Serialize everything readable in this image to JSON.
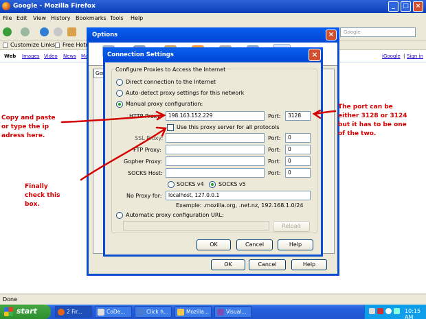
{
  "browser": {
    "title": "Google - Mozilla Firefox",
    "menu": [
      "File",
      "Edit",
      "View",
      "History",
      "Bookmarks",
      "Tools",
      "Help"
    ],
    "search_placeholder": "Google",
    "bookmarks": [
      "Customize Links",
      "Free Hotm"
    ],
    "google_links": [
      "Web",
      "Images",
      "Video",
      "News",
      "Ma"
    ],
    "google_right": [
      "iGoogle",
      "Sign in"
    ],
    "status": "Done"
  },
  "options_dialog": {
    "title": "Options",
    "tab_label": "Gen",
    "ok_label": "OK",
    "cancel_label": "Cancel",
    "help_label": "Help"
  },
  "connection_dialog": {
    "title": "Connection Settings",
    "group_label": "Configure Proxies to Access the Internet",
    "direct_label": "Direct connection to the Internet",
    "autodetect_label": "Auto-detect proxy settings for this network",
    "manual_label": "Manual proxy configuration:",
    "http_label": "HTTP Proxy:",
    "http_value": "198.163.152.229",
    "port_label": "Port:",
    "http_port": "3128",
    "same_proxy_label": "Use this proxy server for all protocols",
    "ssl_label": "SSL Proxy:",
    "ftp_label": "FTP Proxy:",
    "gopher_label": "Gopher Proxy:",
    "socks_label": "SOCKS Host:",
    "zero": "0",
    "socks4_label": "SOCKS v4",
    "socks5_label": "SOCKS v5",
    "no_proxy_label": "No Proxy for:",
    "no_proxy_value": "localhost, 127.0.0.1",
    "example_text": "Example: .mozilla.org, .net.nz, 192.168.1.0/24",
    "auto_url_label": "Automatic proxy configuration URL:",
    "reload_label": "Reload",
    "ok_label": "OK",
    "cancel_label": "Cancel",
    "help_label": "Help",
    "selected_mode": "manual",
    "socks_version": "v5"
  },
  "annotations": {
    "left_1": "Copy and paste",
    "left_2": "or type the ip",
    "left_3": "adress here.",
    "finally_1": "Finally",
    "finally_2": "check this",
    "finally_3": "box.",
    "right_1": "The port can be",
    "right_2": "either 3128 or 3124",
    "right_3": "but it has to be one",
    "right_4": "of the two."
  },
  "taskbar": {
    "start_label": "start",
    "buttons": [
      "2 Fir...",
      "CoDe...",
      "Click h...",
      "Mozilla...",
      "Visual..."
    ],
    "time": "10:15 AM"
  },
  "colors": {
    "annotation": "#d40000",
    "titlebar": "#0a5ff0",
    "start_green": "#3a9d3a"
  }
}
